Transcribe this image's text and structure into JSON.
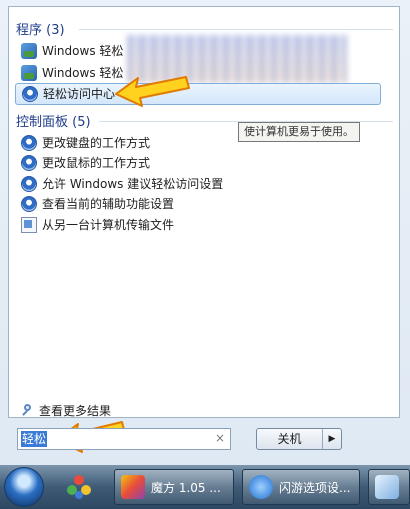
{
  "programs": {
    "title": "程序 (3)",
    "items": [
      {
        "label": "Windows 轻松"
      },
      {
        "label": "Windows 轻松"
      },
      {
        "label": "轻松访问中心"
      }
    ]
  },
  "control_panel": {
    "title": "控制面板 (5)",
    "items": [
      {
        "label": "更改键盘的工作方式"
      },
      {
        "label": "更改鼠标的工作方式"
      },
      {
        "label": "允许 Windows 建议轻松访问设置"
      },
      {
        "label": "查看当前的辅助功能设置"
      },
      {
        "label": "从另一台计算机传输文件"
      }
    ]
  },
  "tooltip": "使计算机更易于使用。",
  "see_more": "查看更多结果",
  "search": {
    "value": "轻松",
    "clear": "×"
  },
  "shutdown": {
    "label": "关机",
    "arrow": "▶"
  },
  "taskbar": {
    "buttons": [
      {
        "label": "魔方 1.05 ..."
      },
      {
        "label": "闪游选项设..."
      }
    ]
  },
  "colors": {
    "accent": "#1f3d8b",
    "highlight_border": "#83aed9",
    "arrow": "#ffd21f"
  }
}
